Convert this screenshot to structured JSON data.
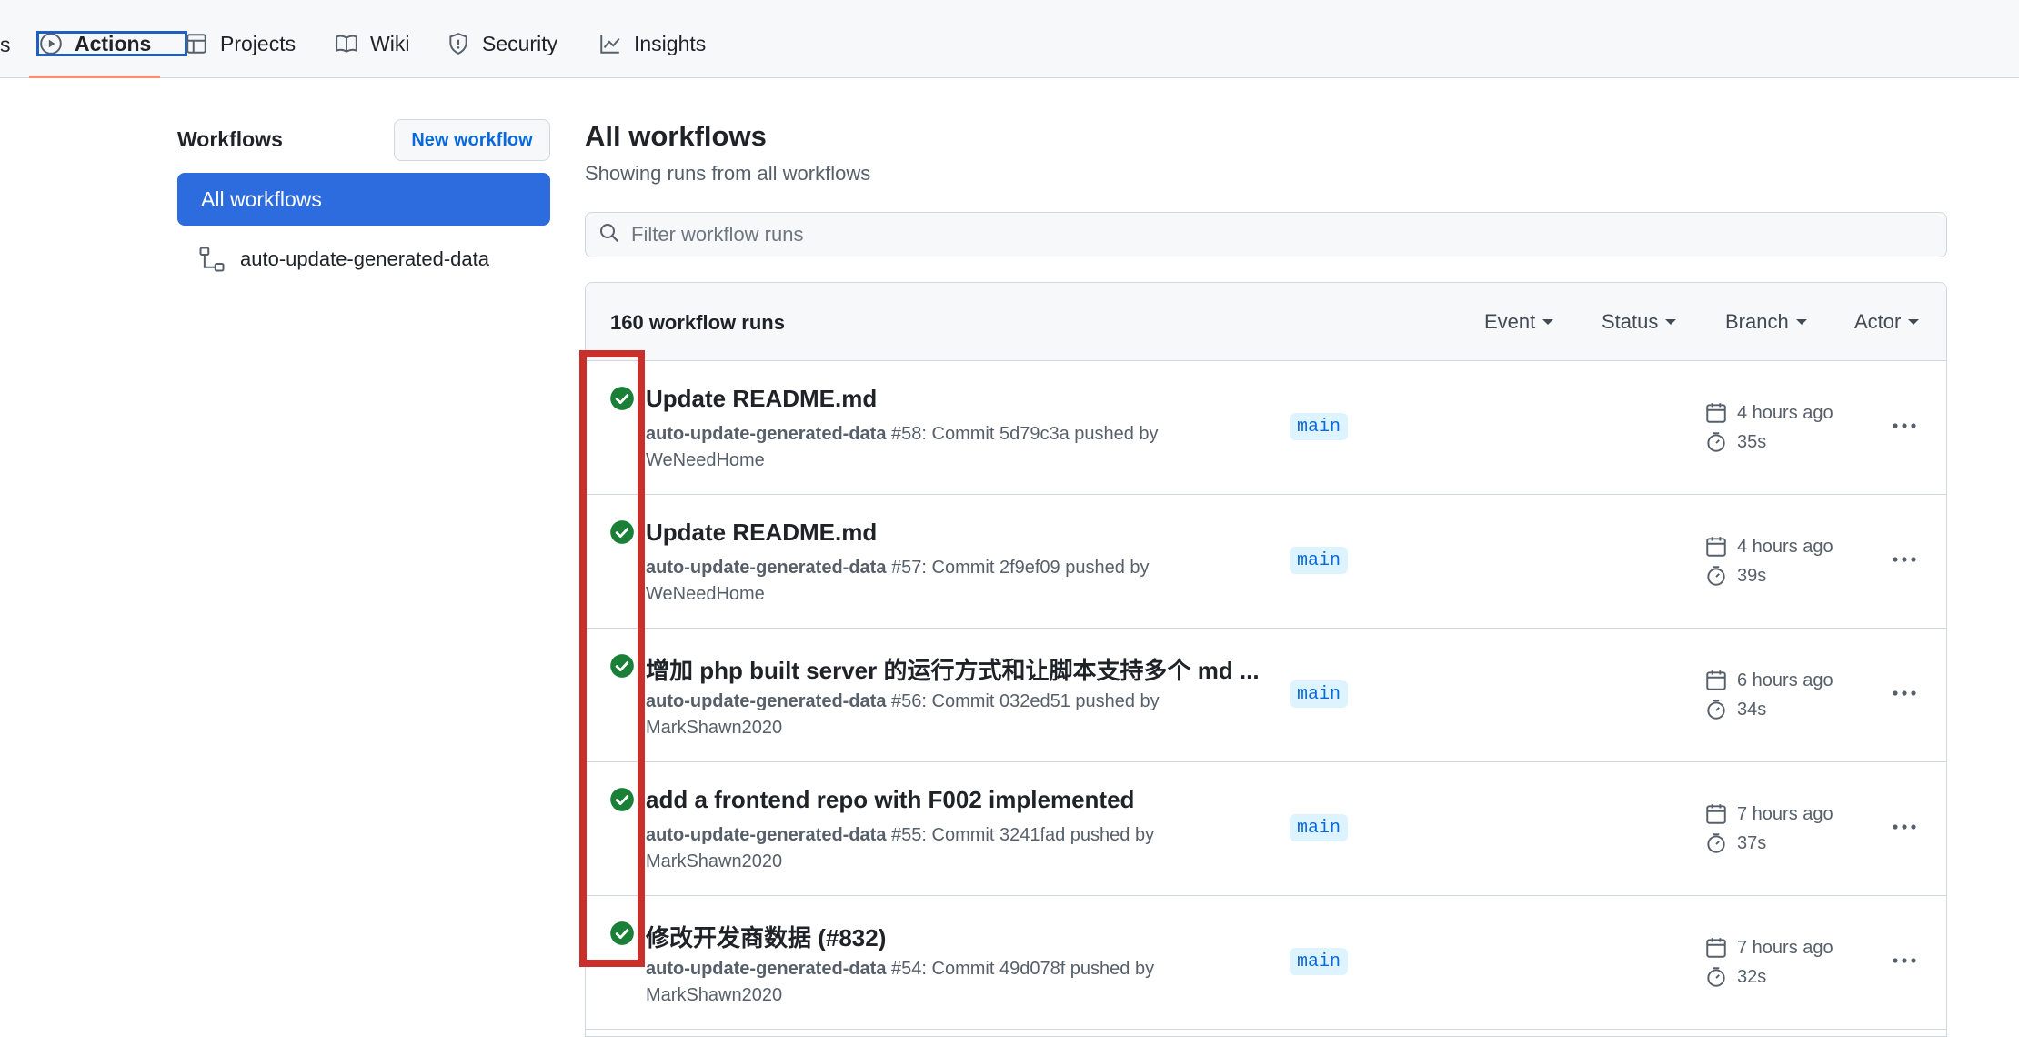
{
  "nav": {
    "edge_fragment": "s",
    "tabs": [
      {
        "label": "Actions",
        "icon": "play-circle-icon"
      },
      {
        "label": "Projects",
        "icon": "table-icon"
      },
      {
        "label": "Wiki",
        "icon": "book-icon"
      },
      {
        "label": "Security",
        "icon": "shield-icon"
      },
      {
        "label": "Insights",
        "icon": "graph-icon"
      }
    ]
  },
  "sidebar": {
    "title": "Workflows",
    "new_workflow_label": "New workflow",
    "all_workflows_label": "All workflows",
    "workflows": [
      {
        "label": "auto-update-generated-data",
        "icon": "workflow-icon"
      }
    ]
  },
  "main": {
    "title": "All workflows",
    "subtitle": "Showing runs from all workflows",
    "filter_placeholder": "Filter workflow runs",
    "runs_count": "160 workflow runs",
    "filters": [
      "Event",
      "Status",
      "Branch",
      "Actor"
    ],
    "runs": [
      {
        "title": "Update README.md",
        "workflow": "auto-update-generated-data",
        "detail": " #58: Commit 5d79c3a pushed by",
        "actor": "WeNeedHome",
        "branch": "main",
        "time": "4 hours ago",
        "duration": "35s",
        "status": "success"
      },
      {
        "title": "Update README.md",
        "workflow": "auto-update-generated-data",
        "detail": " #57: Commit 2f9ef09 pushed by",
        "actor": "WeNeedHome",
        "branch": "main",
        "time": "4 hours ago",
        "duration": "39s",
        "status": "success"
      },
      {
        "title": "增加 php built server 的运行方式和让脚本支持多个 md ...",
        "workflow": "auto-update-generated-data",
        "detail": " #56: Commit 032ed51 pushed by",
        "actor": "MarkShawn2020",
        "branch": "main",
        "time": "6 hours ago",
        "duration": "34s",
        "status": "success"
      },
      {
        "title": "add a frontend repo with F002 implemented",
        "workflow": "auto-update-generated-data",
        "detail": " #55: Commit 3241fad pushed by",
        "actor": "MarkShawn2020",
        "branch": "main",
        "time": "7 hours ago",
        "duration": "37s",
        "status": "success"
      },
      {
        "title": "修改开发商数据 (#832)",
        "workflow": "auto-update-generated-data",
        "detail": " #54: Commit 49d078f pushed by",
        "actor": "MarkShawn2020",
        "branch": "main",
        "time": "7 hours ago",
        "duration": "32s",
        "status": "success"
      }
    ]
  },
  "colors": {
    "accent": "#2d6cdf",
    "success": "#1a7f37",
    "annotation": "#c9302c"
  }
}
